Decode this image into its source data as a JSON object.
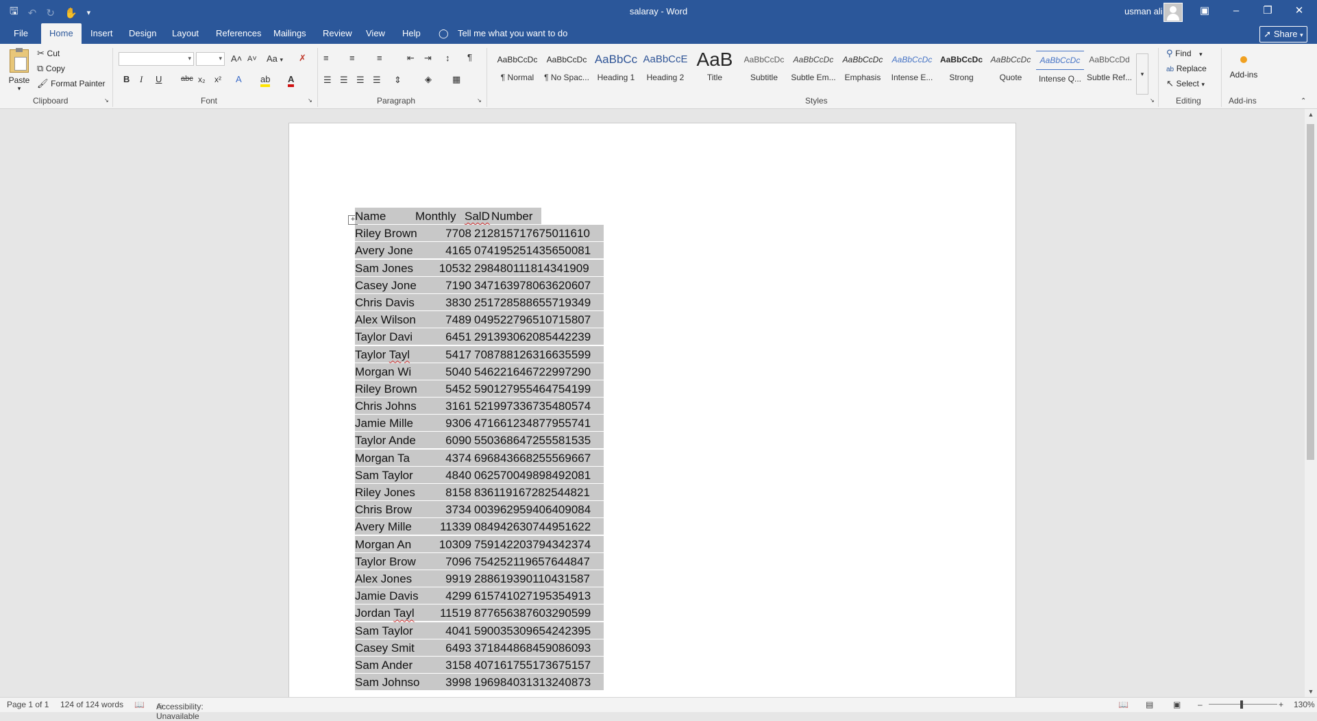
{
  "title_bar": {
    "document": "salaray",
    "separator": "-",
    "app": "Word",
    "user": "usman ali"
  },
  "tabs": [
    "File",
    "Home",
    "Insert",
    "Design",
    "Layout",
    "References",
    "Mailings",
    "Review",
    "View",
    "Help"
  ],
  "active_tab": "Home",
  "tell_me": "Tell me what you want to do",
  "share_label": "Share",
  "clipboard": {
    "paste": "Paste",
    "cut": "Cut",
    "copy": "Copy",
    "format_painter": "Format Painter",
    "group_label": "Clipboard"
  },
  "font_group": {
    "font_name": "",
    "font_size": "",
    "change_case": "Aa",
    "bold": "B",
    "italic": "I",
    "underline": "U",
    "strike": "abc",
    "sub": "x₂",
    "sup": "x²",
    "group_label": "Font"
  },
  "paragraph_group": {
    "group_label": "Paragraph"
  },
  "styles": {
    "group_label": "Styles",
    "items": [
      {
        "preview": "AaBbCcDc",
        "name": "¶ Normal"
      },
      {
        "preview": "AaBbCcDc",
        "name": "¶ No Spac..."
      },
      {
        "preview": "AaBbCc",
        "name": "Heading 1"
      },
      {
        "preview": "AaBbCcE",
        "name": "Heading 2"
      },
      {
        "preview": "AaB",
        "name": "Title"
      },
      {
        "preview": "AaBbCcDc",
        "name": "Subtitle"
      },
      {
        "preview": "AaBbCcDc",
        "name": "Subtle Em..."
      },
      {
        "preview": "AaBbCcDc",
        "name": "Emphasis"
      },
      {
        "preview": "AaBbCcDc",
        "name": "Intense E..."
      },
      {
        "preview": "AaBbCcDc",
        "name": "Strong"
      },
      {
        "preview": "AaBbCcDc",
        "name": "Quote"
      },
      {
        "preview": "AaBbCcDc",
        "name": "Intense Q..."
      },
      {
        "preview": "AaBbCcDd",
        "name": "Subtle Ref..."
      }
    ]
  },
  "editing": {
    "find": "Find",
    "replace": "Replace",
    "select": "Select",
    "group_label": "Editing"
  },
  "addins": {
    "button": "Add-ins",
    "group_label": "Add-ins"
  },
  "table": {
    "headers": [
      "Name",
      "Monthly",
      "SalD",
      "Number"
    ],
    "rows": [
      [
        "Riley Brown",
        "7708",
        "212815717675011610"
      ],
      [
        "Avery Jone",
        "4165",
        "074195251435650081"
      ],
      [
        "Sam Jones",
        "10532",
        "298480111814341909"
      ],
      [
        "Casey Jone",
        "7190",
        "347163978063620607"
      ],
      [
        "Chris Davis",
        "3830",
        "251728588655719349"
      ],
      [
        "Alex Wilson",
        "7489",
        "049522796510715807"
      ],
      [
        "Taylor Davi",
        "6451",
        "291393062085442239"
      ],
      [
        "Taylor Tayl",
        "5417",
        "708788126316635599"
      ],
      [
        "Morgan Wi",
        "5040",
        "546221646722997290"
      ],
      [
        "Riley Brown",
        "5452",
        "590127955464754199"
      ],
      [
        "Chris Johns",
        "3161",
        "521997336735480574"
      ],
      [
        "Jamie Mille",
        "9306",
        "471661234877955741"
      ],
      [
        "Taylor Ande",
        "6090",
        "550368647255581535"
      ],
      [
        "Morgan Ta",
        "4374",
        "696843668255569667"
      ],
      [
        "Sam Taylor",
        "4840",
        "062570049898492081"
      ],
      [
        "Riley Jones",
        "8158",
        "836119167282544821"
      ],
      [
        "Chris Brow",
        "3734",
        "003962959406409084"
      ],
      [
        "Avery Mille",
        "11339",
        "084942630744951622"
      ],
      [
        "Morgan An",
        "10309",
        "759142203794342374"
      ],
      [
        "Taylor Brow",
        "7096",
        "754252119657644847"
      ],
      [
        "Alex Jones",
        "9919",
        "288619390110431587"
      ],
      [
        "Jamie Davis",
        "4299",
        "615741027195354913"
      ],
      [
        "Jordan Tayl",
        "11519",
        "877656387603290599"
      ],
      [
        "Sam Taylor",
        "4041",
        "590035309654242395"
      ],
      [
        "Casey Smit",
        "6493",
        "371844868459086093"
      ],
      [
        "Sam Ander",
        "3158",
        "407161755173675157"
      ],
      [
        "Sam Johnso",
        "3998",
        "196984031313240873"
      ]
    ]
  },
  "status": {
    "page": "Page 1 of 1",
    "words": "124 of 124 words",
    "accessibility": "Accessibility: Unavailable",
    "zoom": "130%"
  }
}
